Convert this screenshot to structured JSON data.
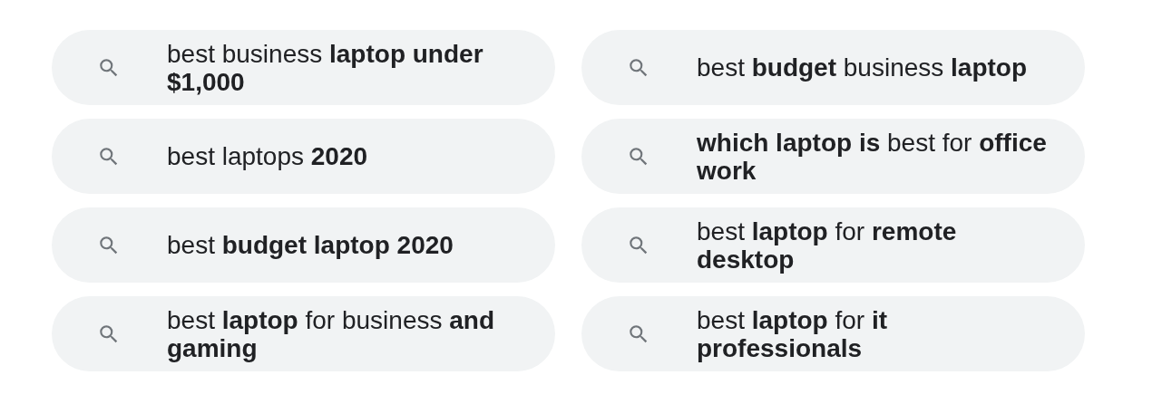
{
  "suggestions": [
    {
      "text": "best business **laptop under $1,000**"
    },
    {
      "text": "best **budget** business **laptop**"
    },
    {
      "text": "best laptops **2020**"
    },
    {
      "text": "**which laptop is** best for **office work**"
    },
    {
      "text": "best **budget laptop 2020**"
    },
    {
      "text": "best **laptop** for **remote desktop**"
    },
    {
      "text": "best **laptop** for business **and gaming**"
    },
    {
      "text": "best **laptop** for **it professionals**"
    }
  ]
}
